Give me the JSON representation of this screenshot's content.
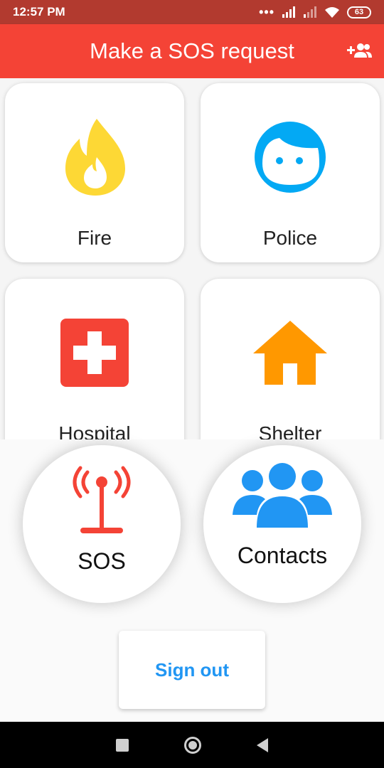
{
  "status_bar": {
    "time": "12:57 PM",
    "battery": "63",
    "icons": [
      "more-dots-icon",
      "signal-icon",
      "signal-weak-icon",
      "wifi-icon",
      "battery-icon"
    ]
  },
  "app_bar": {
    "title": "Make a SOS request",
    "action_icon": "add-contact-icon"
  },
  "categories": [
    {
      "label": "Fire",
      "icon": "fire-icon",
      "color": "#fdd835"
    },
    {
      "label": "Police",
      "icon": "police-face-icon",
      "color": "#03a9f4"
    },
    {
      "label": "Hospital",
      "icon": "hospital-cross-icon",
      "color": "#f44336"
    },
    {
      "label": "Shelter",
      "icon": "house-icon",
      "color": "#ff9800"
    }
  ],
  "actions": {
    "sos_label": "SOS",
    "sos_icon": "antenna-icon",
    "sos_color": "#f44336",
    "contacts_label": "Contacts",
    "contacts_icon": "group-icon",
    "contacts_color": "#2196f3"
  },
  "sign_out": {
    "label": "Sign out",
    "color": "#2196f3"
  },
  "colors": {
    "status_bar": "#b23a2f",
    "app_bar": "#f44336"
  }
}
